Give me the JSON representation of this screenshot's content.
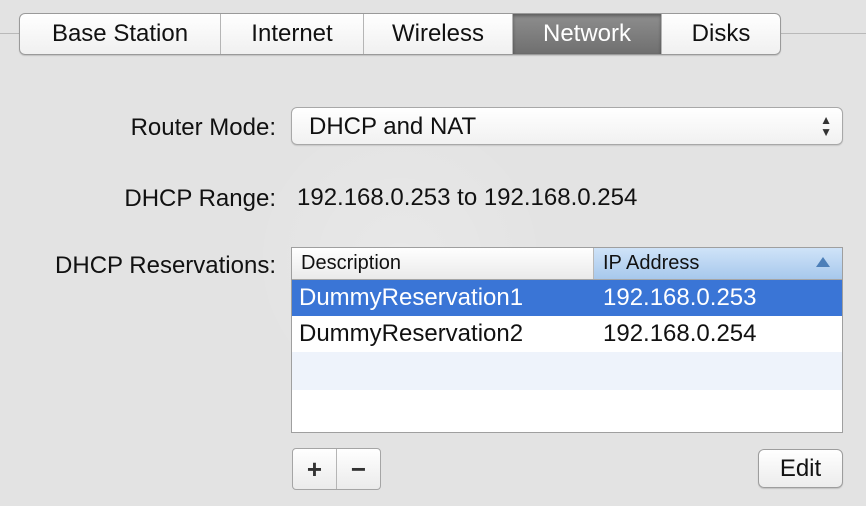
{
  "tabs": [
    {
      "label": "Base Station"
    },
    {
      "label": "Internet"
    },
    {
      "label": "Wireless"
    },
    {
      "label": "Network",
      "selected": true
    },
    {
      "label": "Disks"
    }
  ],
  "router_mode": {
    "label": "Router Mode:",
    "value": "DHCP and NAT"
  },
  "dhcp_range": {
    "label": "DHCP Range:",
    "value": "192.168.0.253 to 192.168.0.254"
  },
  "reservations": {
    "label": "DHCP Reservations:",
    "columns": {
      "description": "Description",
      "ip": "IP Address"
    },
    "rows": [
      {
        "description": "DummyReservation1",
        "ip": "192.168.0.253",
        "selected": true
      },
      {
        "description": "DummyReservation2",
        "ip": "192.168.0.254",
        "selected": false
      }
    ],
    "add_label": "+",
    "remove_label": "−",
    "edit_label": "Edit"
  },
  "colors": {
    "selection": "#3a75d6",
    "selected_tab": "#7f7f7f",
    "sorted_header": "#b9d5f2"
  },
  "icons": {
    "popup": "up-down-chevron-icon",
    "sort": "sort-ascending-icon"
  }
}
